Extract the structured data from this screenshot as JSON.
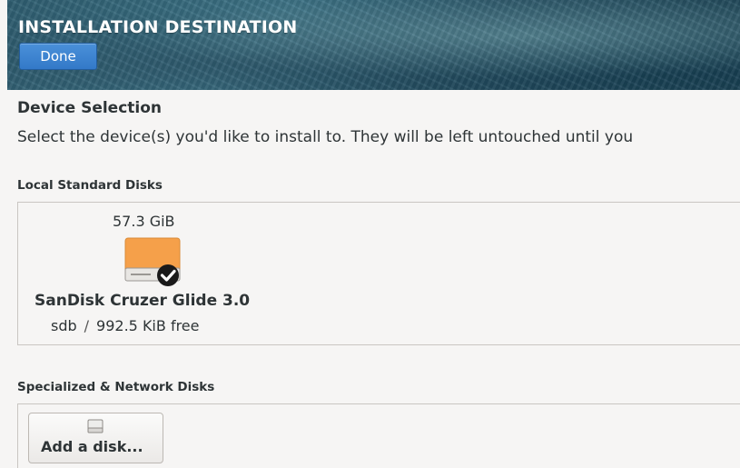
{
  "header": {
    "title": "INSTALLATION DESTINATION",
    "done_label": "Done"
  },
  "device_selection": {
    "heading": "Device Selection",
    "description": "Select the device(s) you'd like to install to.  They will be left untouched until you"
  },
  "local_disks": {
    "label": "Local Standard Disks",
    "disks": [
      {
        "size": "57.3 GiB",
        "name": "SanDisk Cruzer Glide 3.0",
        "device": "sdb",
        "separator": "/",
        "free": "992.5 KiB free",
        "selected": true,
        "icon": "drive-harddisk-icon",
        "icon_color": "#f5a04a"
      }
    ]
  },
  "specialized_disks": {
    "label": "Specialized & Network Disks",
    "add_label": "Add a disk...",
    "add_icon": "disk-add-icon"
  },
  "colors": {
    "accent": "#3379c8",
    "page_bg": "#f6f5f4",
    "text": "#2e3436"
  }
}
